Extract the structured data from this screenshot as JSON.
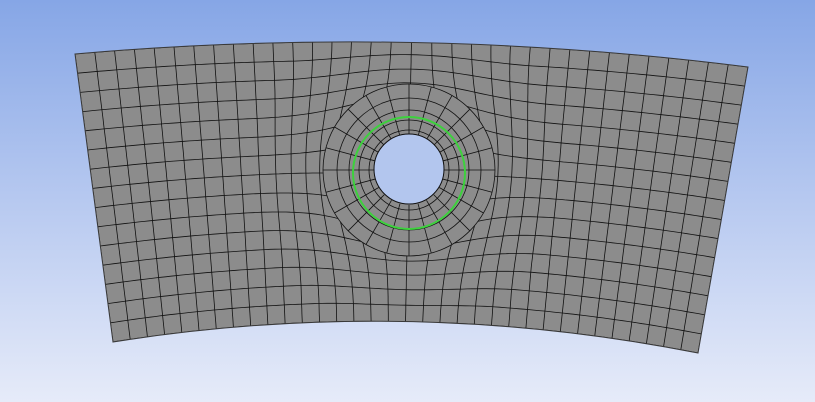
{
  "viewport": {
    "background_top": "#86a6e6",
    "background_bottom": "#e6ebf9"
  },
  "mesh": {
    "face_color": "#8c8c8c",
    "edge_color": "#111111",
    "outline_color": "#3a3a3a",
    "hole_color": "#b3c6ee",
    "selection_ring_color": "#3dd13d"
  }
}
